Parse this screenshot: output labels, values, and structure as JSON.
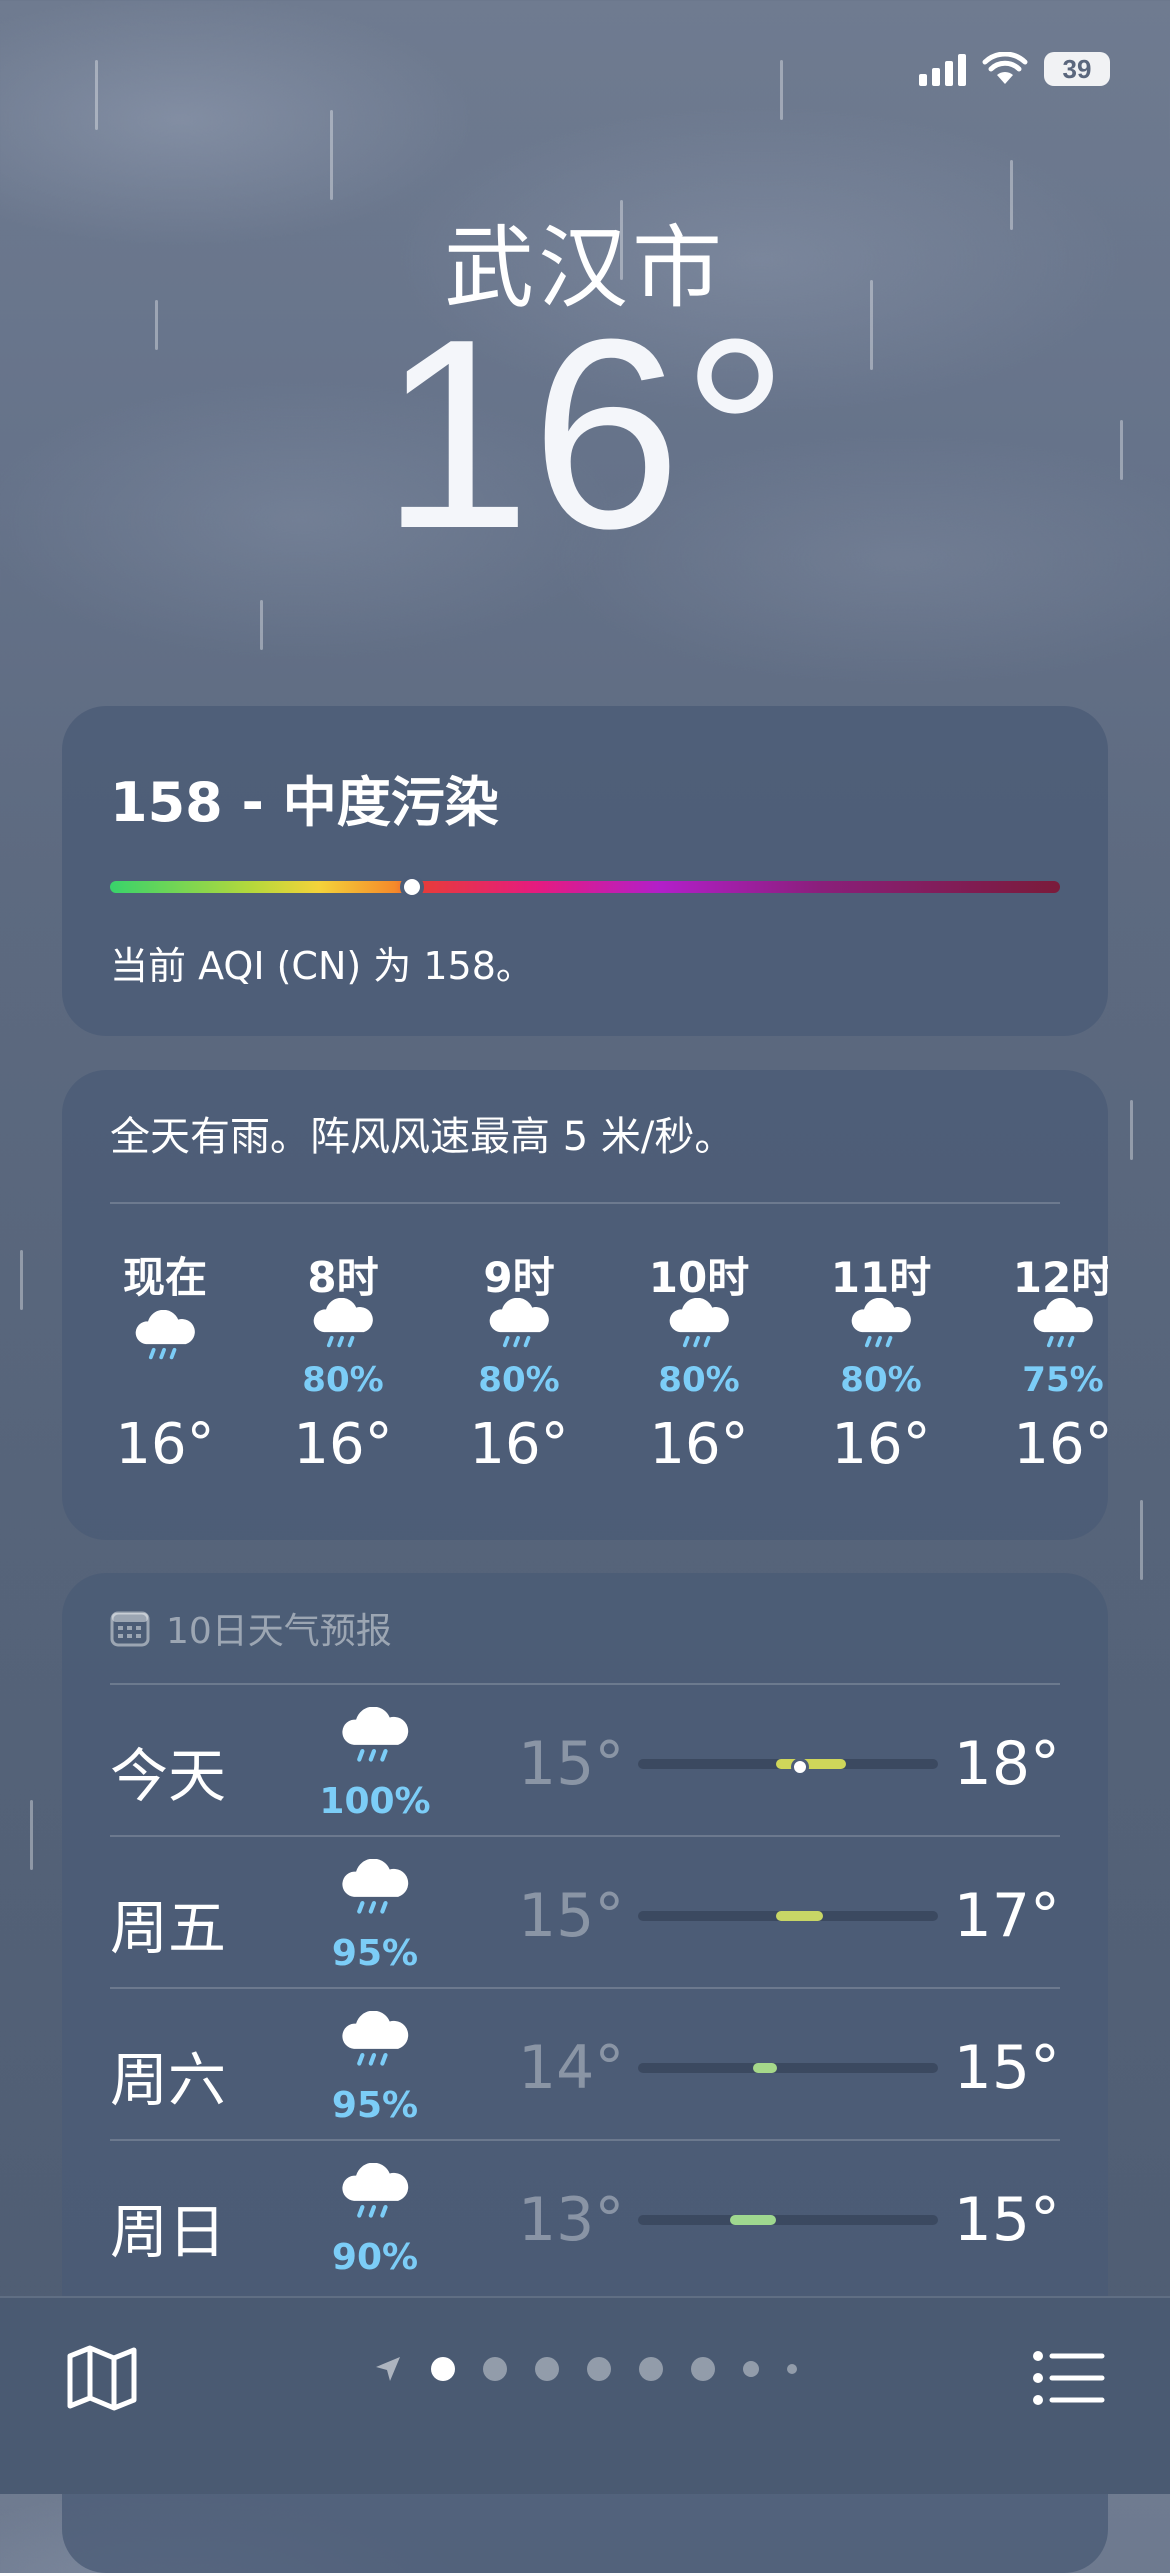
{
  "status": {
    "battery": "39",
    "icons": [
      "signal-icon",
      "wifi-icon",
      "battery-icon"
    ]
  },
  "location": {
    "city": "武汉市",
    "temperature": "16°"
  },
  "aqi": {
    "title": "158 - 中度污染",
    "description": "当前 AQI (CN) 为 158。",
    "value": 158
  },
  "hourly": {
    "summary": "全天有雨。阵风风速最高 5 米/秒。",
    "items": [
      {
        "time": "现在",
        "precip": "",
        "temp": "16°",
        "icon": "rain-cloud-icon"
      },
      {
        "time": "8时",
        "precip": "80%",
        "temp": "16°",
        "icon": "rain-cloud-icon"
      },
      {
        "time": "9时",
        "precip": "80%",
        "temp": "16°",
        "icon": "rain-cloud-icon"
      },
      {
        "time": "10时",
        "precip": "80%",
        "temp": "16°",
        "icon": "rain-cloud-icon"
      },
      {
        "time": "11时",
        "precip": "80%",
        "temp": "16°",
        "icon": "rain-cloud-icon"
      },
      {
        "time": "12时",
        "precip": "75%",
        "temp": "16°",
        "icon": "rain-cloud-icon"
      }
    ]
  },
  "daily": {
    "header": "10日天气预报",
    "items": [
      {
        "day": "今天",
        "precip": "100%",
        "low": "15°",
        "high": "18°",
        "lowVal": 15,
        "highVal": 18,
        "current": 16,
        "color": "#cfd65a"
      },
      {
        "day": "周五",
        "precip": "95%",
        "low": "15°",
        "high": "17°",
        "lowVal": 15,
        "highVal": 17,
        "color": "#c8d666"
      },
      {
        "day": "周六",
        "precip": "95%",
        "low": "14°",
        "high": "15°",
        "lowVal": 14,
        "highVal": 15,
        "color": "#a6d88a"
      },
      {
        "day": "周日",
        "precip": "90%",
        "low": "13°",
        "high": "15°",
        "lowVal": 13,
        "highVal": 15,
        "color": "#9fd88f"
      }
    ],
    "range": [
      9,
      22
    ]
  },
  "pager": {
    "pages": 9,
    "active": 1
  }
}
